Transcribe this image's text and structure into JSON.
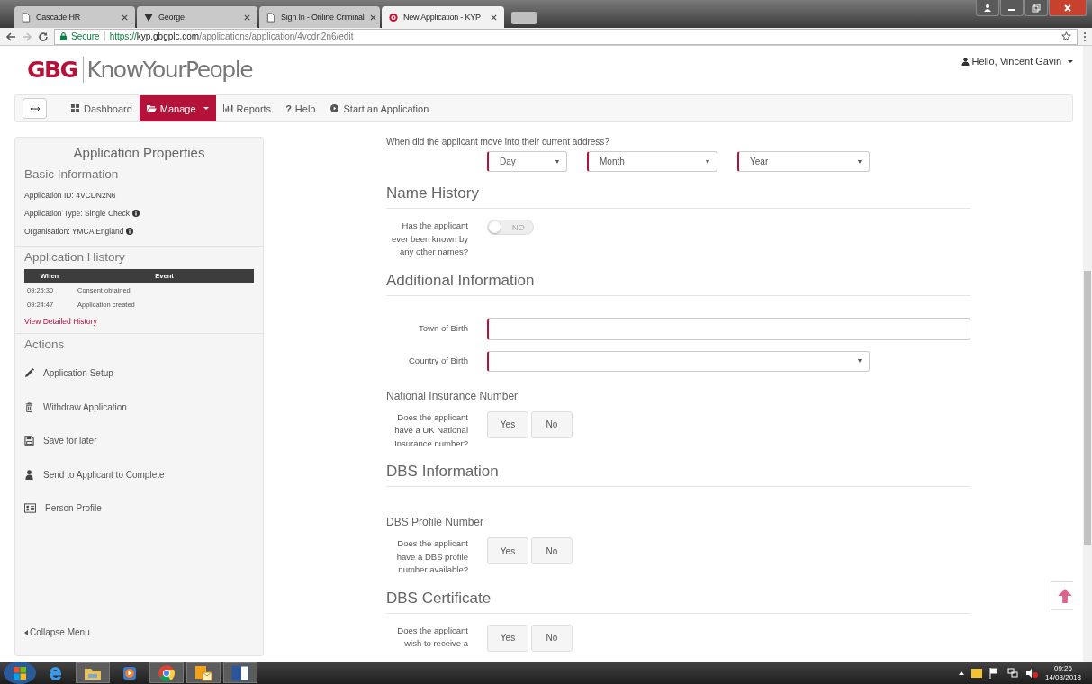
{
  "browser": {
    "tabs": [
      {
        "title": "Cascade HR",
        "selected": false
      },
      {
        "title": "George",
        "selected": false
      },
      {
        "title": "Sign In - Online Criminal",
        "selected": false
      },
      {
        "title": "New Application - KYP",
        "selected": true
      }
    ],
    "secure_label": "Secure",
    "url_scheme": "https://",
    "url_host": "kyp.gbgplc.com",
    "url_path": "/applications/application/4vcdn2n6/edit"
  },
  "header": {
    "brand": "GBG",
    "product": "KnowYourPeople",
    "user_menu": "Hello, Vincent Gavin"
  },
  "nav": [
    {
      "label": "Dashboard",
      "selected": false,
      "has_caret": false
    },
    {
      "label": "Manage",
      "selected": true,
      "has_caret": true
    },
    {
      "label": "Reports",
      "selected": false,
      "has_caret": false
    },
    {
      "label": "Help",
      "glyph": "?",
      "selected": false,
      "has_caret": false
    },
    {
      "label": "Start an Application",
      "selected": false,
      "has_caret": false
    }
  ],
  "sidebar": {
    "title": "Application Properties",
    "basic": {
      "heading": "Basic Information",
      "lines": [
        {
          "text": "Application ID: 4VCDN2N6",
          "info": false
        },
        {
          "text": "Application Type: Single Check",
          "info": true
        },
        {
          "text": "Organisation: YMCA England",
          "info": true
        }
      ]
    },
    "history": {
      "heading": "Application History",
      "columns": [
        "When",
        "Event"
      ],
      "rows": [
        [
          "09:25:30",
          "Consent obtained"
        ],
        [
          "09:24:47",
          "Application created"
        ]
      ],
      "link": "View Detailed History"
    },
    "actions": {
      "heading": "Actions",
      "items": [
        "Application Setup",
        "Withdraw Application",
        "Save for later",
        "Send to Applicant to Complete",
        "Person Profile"
      ]
    },
    "collapse": "Collapse Menu"
  },
  "form": [
    {
      "kind": "question",
      "text": "When did the applicant move into their current address?"
    },
    {
      "kind": "date",
      "selects": [
        "Day",
        "Month",
        "Year"
      ]
    },
    {
      "kind": "heading",
      "text": "Name History"
    },
    {
      "kind": "toggle",
      "label": "Has the applicant ever been known by any other names?",
      "on": false,
      "state_text": "NO"
    },
    {
      "kind": "heading",
      "text": "Additional Information"
    },
    {
      "kind": "text",
      "label": "Town of Birth"
    },
    {
      "kind": "select",
      "label": "Country of Birth"
    },
    {
      "kind": "subheading",
      "text": "National Insurance Number"
    },
    {
      "kind": "yesno",
      "label": "Does the applicant have a UK National Insurance number?",
      "options": [
        {
          "label": "Yes",
          "selected": false
        },
        {
          "label": "No",
          "selected": false
        }
      ]
    },
    {
      "kind": "heading",
      "text": "DBS Information"
    },
    {
      "kind": "subheading",
      "text": "DBS Profile Number"
    },
    {
      "kind": "yesno",
      "label": "Does the applicant have a DBS profile number available?",
      "options": [
        {
          "label": "Yes",
          "selected": false
        },
        {
          "label": "No",
          "selected": false
        }
      ]
    },
    {
      "kind": "heading",
      "text": "DBS Certificate"
    },
    {
      "kind": "yesno",
      "label": "Does the applicant wish to receive a",
      "options": [
        {
          "label": "Yes",
          "selected": false
        },
        {
          "label": "No",
          "selected": false
        }
      ]
    }
  ],
  "taskbar": {
    "time": "09:26",
    "date": "14/03/2018"
  }
}
